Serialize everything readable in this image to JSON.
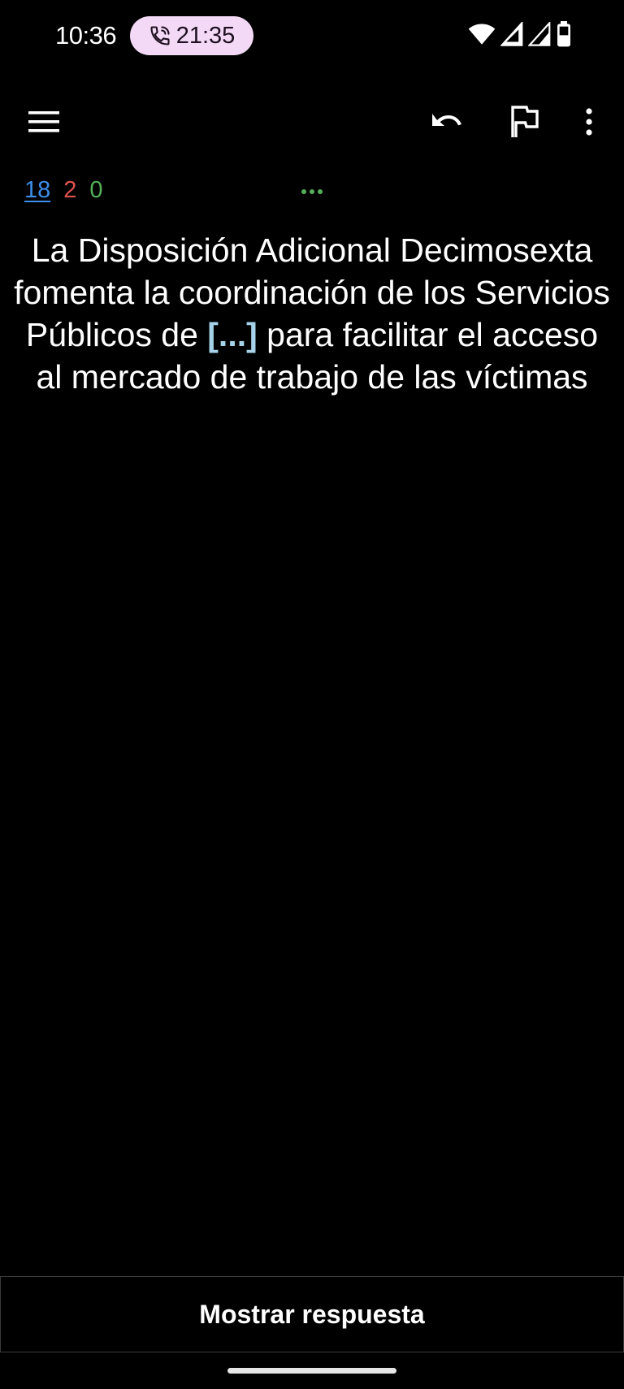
{
  "status_bar": {
    "time": "10:36",
    "call_duration": "21:35"
  },
  "toolbar": {
    "menu_icon": "hamburger-menu-icon",
    "undo_icon": "undo-icon",
    "flag_icon": "flag-icon",
    "more_icon": "more-vert-icon"
  },
  "counts": {
    "new": "18",
    "learning": "2",
    "review": "0"
  },
  "card": {
    "text_before": "La Disposición Adicional Decimosexta fomenta la coordinación de los Servicios Públicos de ",
    "cloze": "[...]",
    "text_after": " para facilitar el acceso al mercado de trabajo de las víctimas"
  },
  "answer_button": {
    "label": "Mostrar respuesta"
  },
  "colors": {
    "new": "#3d8ee8",
    "learning": "#e0524f",
    "review": "#55b05a",
    "cloze": "#a5d2e8",
    "call_chip": "#f3d9f6"
  }
}
